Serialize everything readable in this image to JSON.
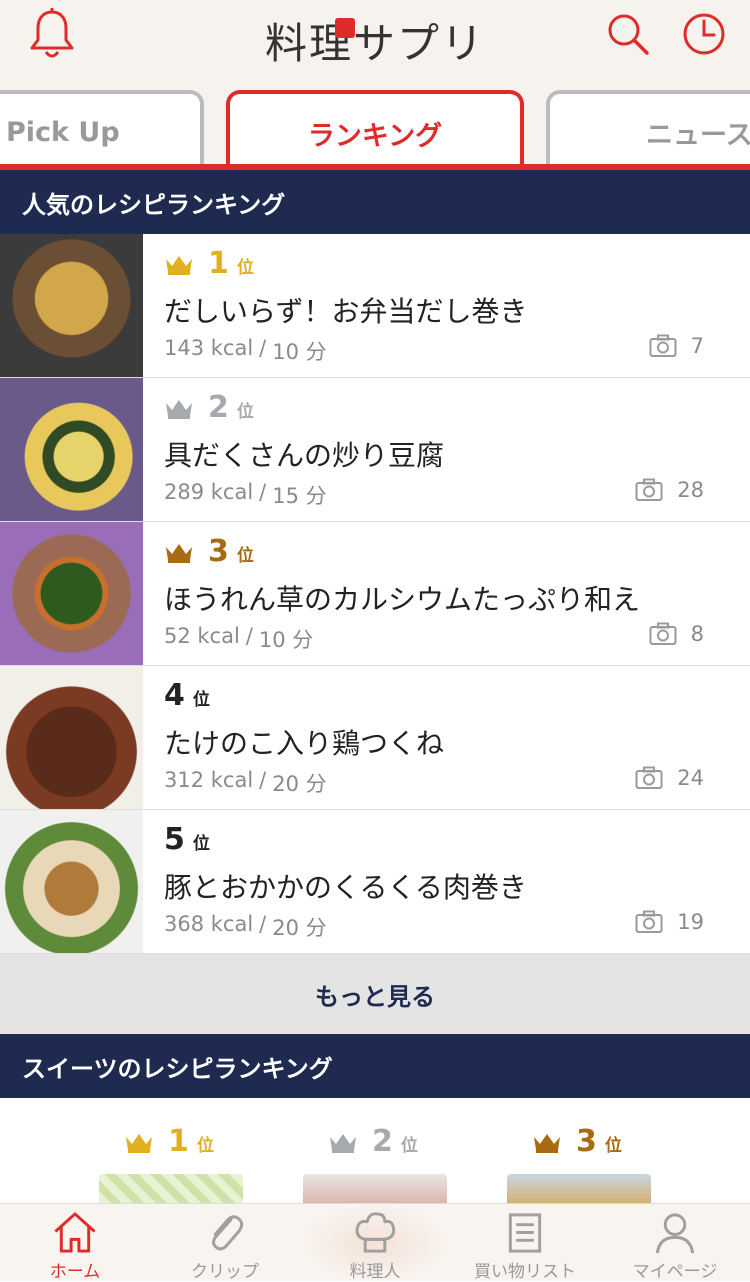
{
  "header": {
    "title": "料理サプリ",
    "left_icon": "bell-icon",
    "right_icons": [
      "search-icon",
      "history-clock-icon"
    ],
    "accent_color": "#e02b2b"
  },
  "tabs": [
    {
      "label": "Pick Up",
      "active": false
    },
    {
      "label": "ランキング",
      "active": true
    },
    {
      "label": "ニュース",
      "active": false
    }
  ],
  "popular": {
    "heading": "人気のレシピランキング",
    "items": [
      {
        "rank": "1",
        "pos": "位",
        "crown_color": "#e0b01f",
        "title": "だしいらず！お弁当だし巻き",
        "kcal": "143 kcal",
        "sep": "/",
        "time": "10 分",
        "photos": "7"
      },
      {
        "rank": "2",
        "pos": "位",
        "crown_color": "#a6a9ad",
        "title": "具だくさんの炒り豆腐",
        "kcal": "289 kcal",
        "sep": "/",
        "time": "15 分",
        "photos": "28"
      },
      {
        "rank": "3",
        "pos": "位",
        "crown_color": "#a86b12",
        "title": "ほうれん草のカルシウムたっぷり和え",
        "kcal": "52 kcal",
        "sep": "/",
        "time": "10 分",
        "photos": "8"
      },
      {
        "rank": "4",
        "pos": "位",
        "crown_color": "",
        "title": "たけのこ入り鶏つくね",
        "kcal": "312 kcal",
        "sep": "/",
        "time": "20 分",
        "photos": "24"
      },
      {
        "rank": "5",
        "pos": "位",
        "crown_color": "",
        "title": "豚とおかかのくるくる肉巻き",
        "kcal": "368 kcal",
        "sep": "/",
        "time": "20 分",
        "photos": "19"
      }
    ],
    "more_label": "もっと見る"
  },
  "sweets": {
    "heading": "スイーツのレシピランキング",
    "items": [
      {
        "rank": "1",
        "pos": "位",
        "crown_color": "#e0b01f"
      },
      {
        "rank": "2",
        "pos": "位",
        "crown_color": "#a6a9ad"
      },
      {
        "rank": "3",
        "pos": "位",
        "crown_color": "#a86b12"
      }
    ]
  },
  "bottom_nav": [
    {
      "label": "ホーム",
      "icon": "home-icon",
      "active": true
    },
    {
      "label": "クリップ",
      "icon": "paperclip-icon",
      "active": false
    },
    {
      "label": "料理人",
      "icon": "chef-hat-icon",
      "active": false
    },
    {
      "label": "買い物リスト",
      "icon": "shopping-list-icon",
      "active": false
    },
    {
      "label": "マイページ",
      "icon": "user-icon",
      "active": false
    }
  ]
}
